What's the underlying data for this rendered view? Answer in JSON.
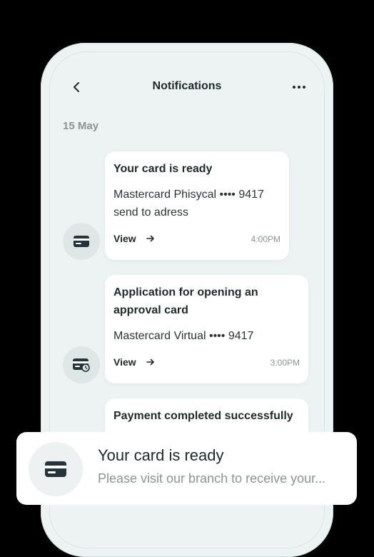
{
  "header": {
    "title": "Notifications"
  },
  "date_label": "15 May",
  "notifications": [
    {
      "title": "Your card is ready",
      "body_line1": "Mastercard Phisycal •••• 9417",
      "body_line2": "send to adress",
      "view_label": "View",
      "time": "4:00PM",
      "icon": "card-icon"
    },
    {
      "title_line1": "Application for opening an",
      "title_line2": "approval card",
      "body_line1": "Mastercard Virtual •••• 9417",
      "view_label": "View",
      "time": "3:00PM",
      "icon": "card-clock-icon"
    },
    {
      "title": "Payment completed successfully"
    }
  ],
  "toast": {
    "title": "Your card is ready",
    "body": "Please visit our branch to receive your...",
    "icon": "card-icon"
  },
  "colors": {
    "background": "#000000",
    "phone": "#ecf3f2",
    "card": "#ffffff",
    "text": "#1f2a2b",
    "muted": "#8b9493"
  }
}
